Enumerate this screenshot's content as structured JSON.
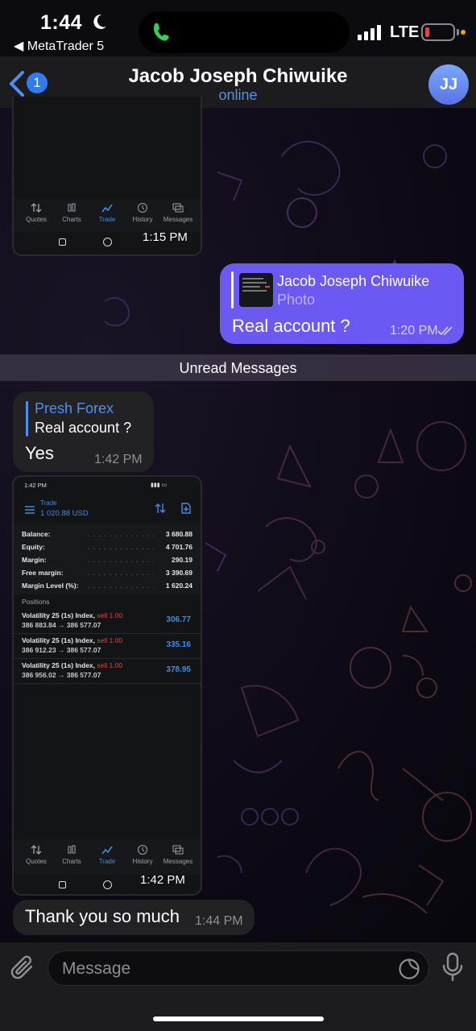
{
  "status_bar": {
    "time": "1:44",
    "back_app": "◀ MetaTrader 5",
    "network": "LTE"
  },
  "header": {
    "badge_count": "1",
    "contact_name": "Jacob Joseph Chiwuike",
    "status": "online",
    "avatar_initials": "JJ"
  },
  "messages": {
    "top_shot": {
      "time": "1:15 PM",
      "tabs": [
        "Quotes",
        "Charts",
        "Trade",
        "History",
        "Messages"
      ]
    },
    "outgoing": {
      "reply_name": "Jacob Joseph Chiwuike",
      "reply_type": "Photo",
      "text": "Real account ?",
      "time": "1:20 PM"
    },
    "unread_divider": "Unread Messages",
    "reply_in": {
      "reply_name": "Presh Forex",
      "reply_text": "Real account ?",
      "text": "Yes",
      "time": "1:42 PM"
    },
    "trade_shot": {
      "status_time": "1:42 PM",
      "header_title": "Trade",
      "header_balance": "1 020.88 USD",
      "rows": [
        {
          "label": "Balance:",
          "value": "3 680.88"
        },
        {
          "label": "Equity:",
          "value": "4 701.76"
        },
        {
          "label": "Margin:",
          "value": "290.19"
        },
        {
          "label": "Free margin:",
          "value": "3 390.69"
        },
        {
          "label": "Margin Level (%):",
          "value": "1 620.24"
        }
      ],
      "positions_label": "Positions",
      "positions": [
        {
          "symbol": "Volatility 25 (1s) Index,",
          "side": "sell 1.00",
          "prices": "386 883.84 → 386 577.07",
          "profit": "306.77"
        },
        {
          "symbol": "Volatility 25 (1s) Index,",
          "side": "sell 1.00",
          "prices": "386 912.23 → 386 577.07",
          "profit": "335.16"
        },
        {
          "symbol": "Volatility 25 (1s) Index,",
          "side": "sell 1.00",
          "prices": "386 956.02 → 386 577.07",
          "profit": "378.95"
        }
      ],
      "tabs": [
        "Quotes",
        "Charts",
        "Trade",
        "History",
        "Messages"
      ],
      "time": "1:42 PM"
    },
    "last": {
      "text": "Thank you so much",
      "time": "1:44 PM"
    }
  },
  "input": {
    "placeholder": "Message"
  },
  "colors": {
    "accent": "#4f8ff0",
    "outgoing_bubble": "#6a5af3",
    "incoming_bubble": "#222225",
    "mt5_blue": "#3a8ee6",
    "sell_red": "#e0473f"
  }
}
